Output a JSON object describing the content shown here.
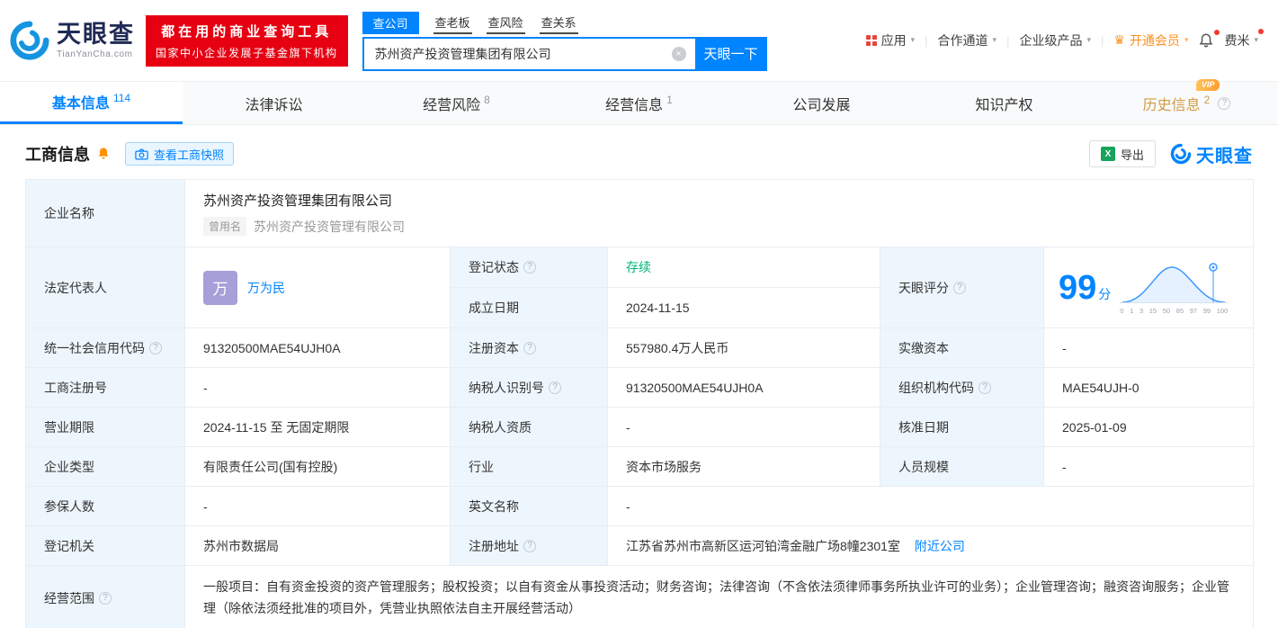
{
  "colors": {
    "brand_blue": "#0084ff",
    "banner_red": "#e60012",
    "status_green": "#00b578",
    "vip_gold": "#ff9d2e"
  },
  "icons": {
    "help": "?",
    "caret": "▾",
    "clear": "×",
    "crown": "♛",
    "sep": "|",
    "excel": "X"
  },
  "brand": {
    "name": "天眼查",
    "domain": "TianYanCha.com"
  },
  "banner": {
    "line1": "都在用的商业查询工具",
    "line2": "国家中小企业发展子基金旗下机构"
  },
  "search": {
    "tabs": [
      "查公司",
      "查老板",
      "查风险",
      "查关系"
    ],
    "value": "苏州资产投资管理集团有限公司",
    "button": "天眼一下"
  },
  "nav": {
    "apps": "应用",
    "partner": "合作通道",
    "enterprise": "企业级产品",
    "vip": "开通会员",
    "user": "费米"
  },
  "tabs": {
    "basic": {
      "label": "基本信息",
      "count": "114"
    },
    "legal": {
      "label": "法律诉讼"
    },
    "risk": {
      "label": "经营风险",
      "count": "8"
    },
    "operation": {
      "label": "经营信息",
      "count": "1"
    },
    "development": {
      "label": "公司发展"
    },
    "ip": {
      "label": "知识产权"
    },
    "history": {
      "label": "历史信息",
      "count": "2",
      "badge": "VIP"
    }
  },
  "section": {
    "title": "工商信息",
    "snapshot_button": "查看工商快照",
    "export_button": "导出",
    "watermark": "天眼查"
  },
  "info": {
    "company_name": {
      "label": "企业名称",
      "value": "苏州资产投资管理集团有限公司",
      "former_tag": "曾用名",
      "former_value": "苏州资产投资管理有限公司"
    },
    "legal_rep": {
      "label": "法定代表人",
      "avatar": "万",
      "value": "万为民"
    },
    "reg_status": {
      "label": "登记状态",
      "value": "存续"
    },
    "establish_date": {
      "label": "成立日期",
      "value": "2024-11-15"
    },
    "score": {
      "label": "天眼评分",
      "value": "99",
      "unit": "分",
      "axis": [
        "0",
        "1",
        "3",
        "15",
        "50",
        "85",
        "97",
        "99",
        "100"
      ]
    },
    "credit_code": {
      "label": "统一社会信用代码",
      "value": "91320500MAE54UJH0A"
    },
    "reg_capital": {
      "label": "注册资本",
      "value": "557980.4万人民币"
    },
    "paid_capital": {
      "label": "实缴资本",
      "value": "-"
    },
    "reg_number": {
      "label": "工商注册号",
      "value": "-"
    },
    "taxpayer_id": {
      "label": "纳税人识别号",
      "value": "91320500MAE54UJH0A"
    },
    "org_code": {
      "label": "组织机构代码",
      "value": "MAE54UJH-0"
    },
    "business_term": {
      "label": "营业期限",
      "value": "2024-11-15 至 无固定期限"
    },
    "taxpayer_quality": {
      "label": "纳税人资质",
      "value": "-"
    },
    "approval_date": {
      "label": "核准日期",
      "value": "2025-01-09"
    },
    "company_type": {
      "label": "企业类型",
      "value": "有限责任公司(国有控股)"
    },
    "industry": {
      "label": "行业",
      "value": "资本市场服务"
    },
    "staff_size": {
      "label": "人员规模",
      "value": "-"
    },
    "insured_count": {
      "label": "参保人数",
      "value": "-"
    },
    "english_name": {
      "label": "英文名称",
      "value": "-"
    },
    "reg_authority": {
      "label": "登记机关",
      "value": "苏州市数据局"
    },
    "reg_address": {
      "label": "注册地址",
      "value": "江苏省苏州市高新区运河铂湾金融广场8幢2301室",
      "link": "附近公司"
    },
    "business_scope": {
      "label": "经营范围",
      "value": "一般项目：自有资金投资的资产管理服务；股权投资；以自有资金从事投资活动；财务咨询；法律咨询（不含依法须律师事务所执业许可的业务）；企业管理咨询；融资咨询服务；企业管理（除依法须经批准的项目外，凭营业执照依法自主开展经营活动）"
    }
  }
}
